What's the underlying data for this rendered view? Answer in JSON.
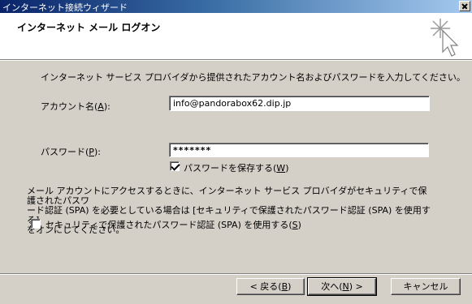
{
  "window": {
    "title": "インターネット接続ウィザード"
  },
  "header": {
    "title": "インターネット メール ログオン",
    "icon": "wizard-sparkle-cursor-icon"
  },
  "instruction": "インターネット サービス プロバイダから提供されたアカウント名およびパスワードを入力してください。",
  "account": {
    "label_text": "アカウント名(",
    "label_key": "A",
    "label_end": "):",
    "value": "info@pandorabox62.dip.jp"
  },
  "password": {
    "label_text": "パスワード(",
    "label_key": "P",
    "label_end": "):",
    "value": "*******"
  },
  "save_password": {
    "label_text": "パスワードを保存する(",
    "label_key": "W",
    "label_end": ")",
    "checked": true
  },
  "spa_note": {
    "line1": "メール アカウントにアクセスするときに、インターネット サービス プロバイダがセキュリティで保護されたパスワ",
    "line2": "ード認証 (SPA) を必要としている場合は [セキュリティで保護されたパスワード認証 (SPA) を使用する]",
    "line3": "をオンにしてください。"
  },
  "spa_checkbox": {
    "label_text": "セキュリティで保護されたパスワード認証 (SPA) を使用する(",
    "label_key": "S",
    "label_end": ")",
    "checked": false
  },
  "buttons": {
    "back_text": "< 戻る(",
    "back_key": "B",
    "back_end": ")",
    "next_text": "次へ(",
    "next_key": "N",
    "next_end": ") >",
    "cancel": "キャンセル"
  }
}
